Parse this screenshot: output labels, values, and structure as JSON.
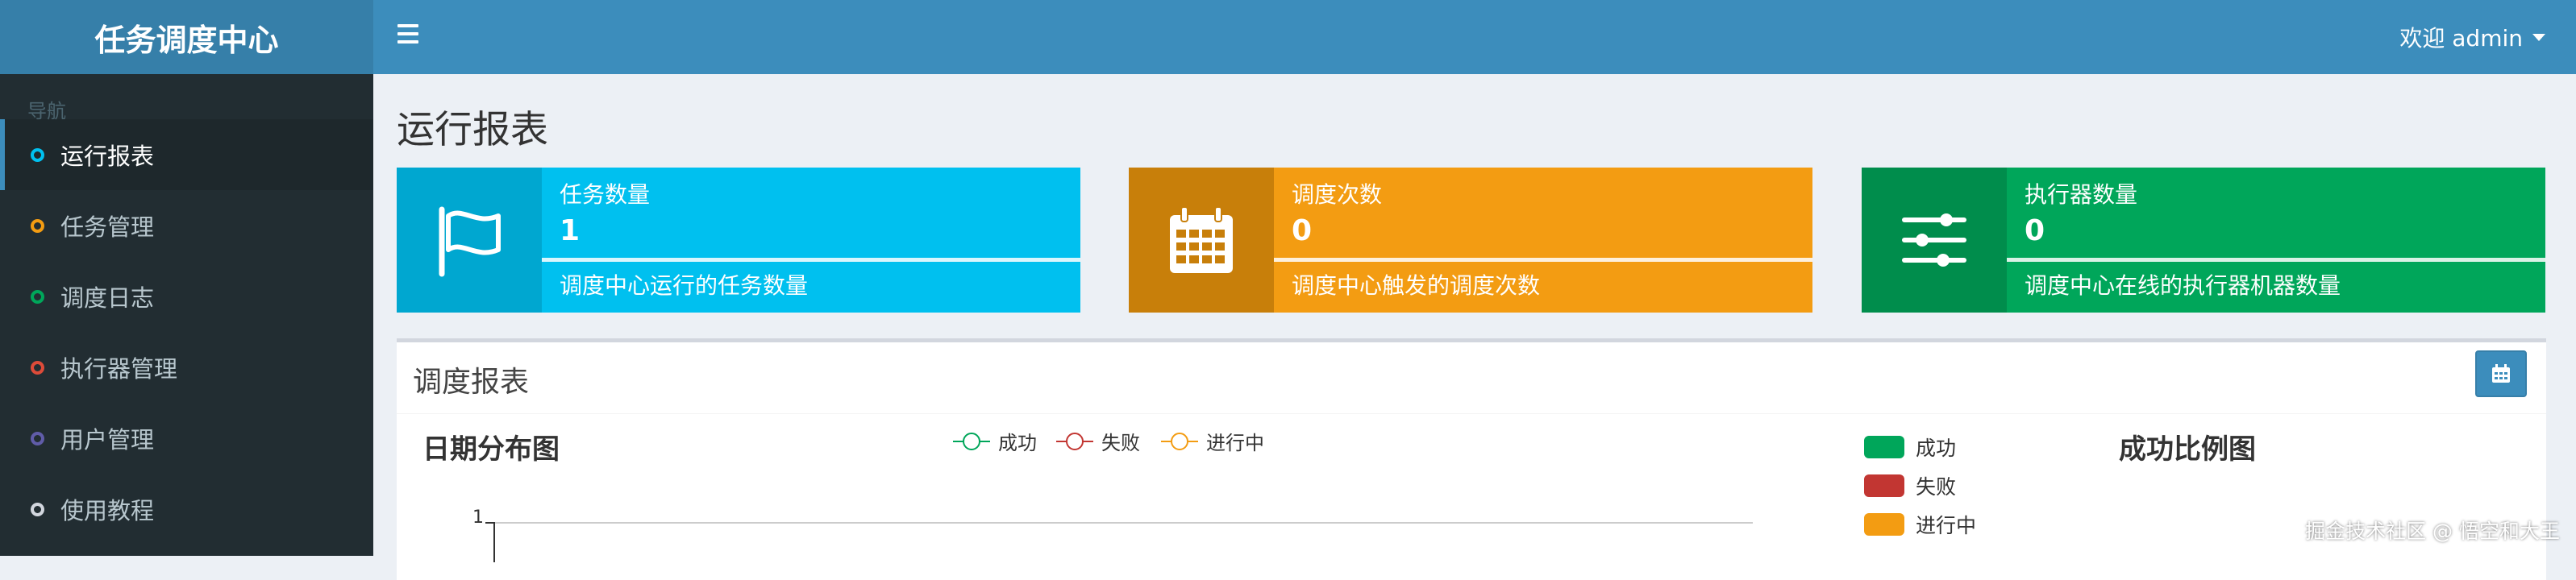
{
  "app": {
    "title": "任务调度中心"
  },
  "topbar": {
    "welcome": "欢迎 admin"
  },
  "sidebar": {
    "header": "导航",
    "items": [
      {
        "label": "运行报表",
        "active": true,
        "color": "#00c0ef"
      },
      {
        "label": "任务管理",
        "active": false,
        "color": "#f39c12"
      },
      {
        "label": "调度日志",
        "active": false,
        "color": "#00a65a"
      },
      {
        "label": "执行器管理",
        "active": false,
        "color": "#dd4b39"
      },
      {
        "label": "用户管理",
        "active": false,
        "color": "#605ca8"
      },
      {
        "label": "使用教程",
        "active": false,
        "color": "#d2d6de"
      }
    ]
  },
  "page": {
    "title": "运行报表"
  },
  "info_boxes": [
    {
      "label": "任务数量",
      "number": "1",
      "desc": "调度中心运行的任务数量",
      "icon": "flag-icon",
      "bg": "#00c0ef",
      "icon_bg": "#00a7d0"
    },
    {
      "label": "调度次数",
      "number": "0",
      "desc": "调度中心触发的调度次数",
      "icon": "calendar-icon",
      "bg": "#f39c12",
      "icon_bg": "#c87f0a"
    },
    {
      "label": "执行器数量",
      "number": "0",
      "desc": "调度中心在线的执行器机器数量",
      "icon": "sliders-icon",
      "bg": "#00a65a",
      "icon_bg": "#008d4c"
    }
  ],
  "report": {
    "title": "调度报表",
    "date_chart_title": "日期分布图",
    "ratio_chart_title": "成功比例图",
    "line_legend": [
      {
        "name": "成功",
        "color": "#00a65a"
      },
      {
        "name": "失败",
        "color": "#c23632"
      },
      {
        "name": "进行中",
        "color": "#f39c12"
      }
    ],
    "pie_legend": [
      {
        "name": "成功",
        "color": "#00a65a"
      },
      {
        "name": "失败",
        "color": "#c23632"
      },
      {
        "name": "进行中",
        "color": "#f39c12"
      }
    ],
    "y_tick": "1"
  },
  "chart_data": [
    {
      "type": "line",
      "title": "日期分布图",
      "series": [
        {
          "name": "成功",
          "values": []
        },
        {
          "name": "失败",
          "values": []
        },
        {
          "name": "进行中",
          "values": []
        }
      ],
      "y_ticks": [
        "1"
      ],
      "legend": "top"
    },
    {
      "type": "pie",
      "title": "成功比例图",
      "categories": [
        "成功",
        "失败",
        "进行中"
      ],
      "legend": "left"
    }
  ],
  "watermark": "掘金技术社区 @ 悟空和大王"
}
